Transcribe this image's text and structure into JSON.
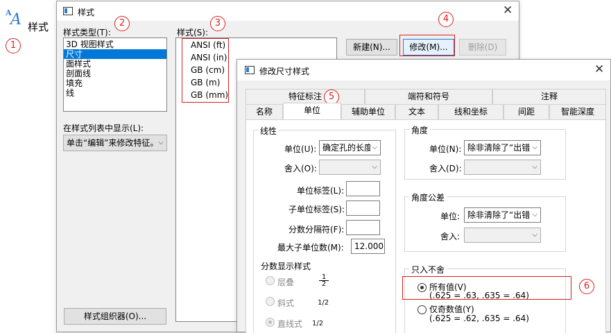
{
  "app": {
    "icon_glyph": "A",
    "label": "样式"
  },
  "styles_dialog": {
    "title": "样式",
    "style_type_label": "样式类型(T):",
    "style_types": [
      "3D 视图样式",
      "尺寸",
      "面样式",
      "剖面线",
      "填充",
      "线"
    ],
    "selected_type_index": 1,
    "styles_label": "样式(S):",
    "styles": [
      "ANSI (ft)",
      "ANSI (in)",
      "GB (cm)",
      "GB (m)",
      "GB (mm)"
    ],
    "show_label": "在样式列表中显示(L):",
    "show_value": "单击“编辑”来修改特征。",
    "new_button": "新建(N)...",
    "modify_button": "修改(M)...",
    "delete_button": "删除(D)",
    "organizer_button": "样式组织器(O)..."
  },
  "modify_dialog": {
    "title": "修改尺寸样式",
    "tabs_row1": [
      "特征标注",
      "端符和符号",
      "注释"
    ],
    "tabs_row2": [
      "名称",
      "单位",
      "辅助单位",
      "文本",
      "线和坐标",
      "间距",
      "智能深度"
    ],
    "active_tab": "单位",
    "linear": {
      "title": "线性",
      "unit_label": "单位(U):",
      "unit_value": "确定孔的长度",
      "round_label": "舍入(O):",
      "round_value": "",
      "unit_tag_label": "单位标签(L):",
      "unit_tag_value": "",
      "subunit_tag_label": "子单位标签(S):",
      "subunit_tag_value": "",
      "fraction_sep_label": "分数分隔符(F):",
      "fraction_sep_value": "",
      "max_subunits_label": "最大子单位数(M):",
      "max_subunits_value": "12.000",
      "fraction_style_title": "分数显示样式",
      "fraction_options": [
        {
          "label": "层叠",
          "sample_num": "1",
          "sample_den": "2",
          "checked": false
        },
        {
          "label": "斜式",
          "sample": "1/2",
          "checked": false
        },
        {
          "label": "直线式",
          "sample": "1/2",
          "checked": true
        }
      ]
    },
    "angle": {
      "title": "角度",
      "unit_label": "单位(N):",
      "unit_value": "除非清除了“出错",
      "round_label": "舍入(D):",
      "round_value": ""
    },
    "angle_tol": {
      "title": "角度公差",
      "unit_label": "单位:",
      "unit_value": "除非清除了“出错",
      "round_label": "舍入:",
      "round_value": ""
    },
    "rounding": {
      "title": "只入不舍",
      "options": [
        {
          "label": "所有值(V)",
          "example": "(.625 = .63, .635 = .64)",
          "checked": true
        },
        {
          "label": "仅奇数值(Y)",
          "example": "(.625 = .62, .635 = .64)",
          "checked": false
        }
      ]
    }
  },
  "annotations": [
    "1",
    "2",
    "3",
    "4",
    "5",
    "6"
  ],
  "colors": {
    "annotation": "#d81e1e",
    "selection": "#0078d7"
  }
}
